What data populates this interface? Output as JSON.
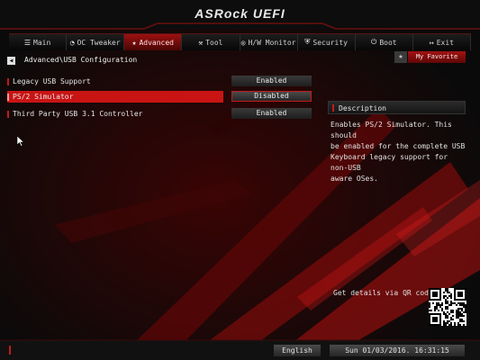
{
  "header": {
    "brand": "ASRock UEFI"
  },
  "nav": {
    "tabs": [
      {
        "label": "Main",
        "icon": "list-icon",
        "glyph": "☰",
        "active": false
      },
      {
        "label": "OC Tweaker",
        "icon": "gauge-icon",
        "glyph": "◔",
        "active": false
      },
      {
        "label": "Advanced",
        "icon": "star-icon",
        "glyph": "★",
        "active": true
      },
      {
        "label": "Tool",
        "icon": "tools-icon",
        "glyph": "⚒",
        "active": false
      },
      {
        "label": "H/W Monitor",
        "icon": "monitor-icon",
        "glyph": "◎",
        "active": false
      },
      {
        "label": "Security",
        "icon": "shield-icon",
        "glyph": "⛨",
        "active": false
      },
      {
        "label": "Boot",
        "icon": "power-icon",
        "glyph": "⏻",
        "active": false
      },
      {
        "label": "Exit",
        "icon": "exit-icon",
        "glyph": "↦",
        "active": false
      }
    ]
  },
  "breadcrumb": "Advanced\\USB Configuration",
  "favorite": {
    "label": "My Favorite"
  },
  "settings": [
    {
      "label": "Legacy USB Support",
      "value": "Enabled",
      "selected": false
    },
    {
      "label": "PS/2 Simulator",
      "value": "Disabled",
      "selected": true
    },
    {
      "label": "Third Party USB 3.1 Controller",
      "value": "Enabled",
      "selected": false
    }
  ],
  "description": {
    "title": "Description",
    "lines": [
      "Enables PS/2 Simulator. This should",
      "be enabled for the complete USB",
      "Keyboard legacy support for non-USB",
      "aware OSes."
    ]
  },
  "qr": {
    "label": "Get details via QR code"
  },
  "footer": {
    "language": "English",
    "datetime": "Sun 01/03/2016. 16:31:15"
  },
  "colors": {
    "accent": "#c91414",
    "background": "#0b0b0b",
    "text": "#e6e6e6"
  }
}
